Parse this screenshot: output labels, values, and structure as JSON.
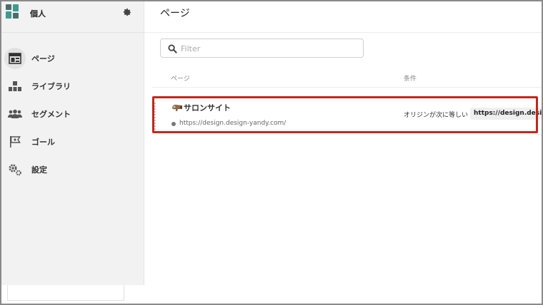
{
  "sidebar": {
    "workspace_name": "個人",
    "items": [
      {
        "label": "ページ",
        "icon": "page-layout-icon",
        "active": true
      },
      {
        "label": "ライブラリ",
        "icon": "library-blocks-icon",
        "active": false
      },
      {
        "label": "セグメント",
        "icon": "users-group-icon",
        "active": false
      },
      {
        "label": "ゴール",
        "icon": "goal-flag-icon",
        "active": false
      },
      {
        "label": "設定",
        "icon": "settings-gears-icon",
        "active": false
      }
    ]
  },
  "main": {
    "title": "ページ",
    "filter": {
      "placeholder": "Filter",
      "value": ""
    },
    "table": {
      "columns": [
        "ページ",
        "条件"
      ],
      "rows": [
        {
          "title": "サロンサイト",
          "url": "https://design.design-yandy.com/",
          "condition_label": "オリジンが次に等しい",
          "condition_value": "https://design.design-yandy.com"
        }
      ]
    }
  },
  "colors": {
    "sidebar_bg": "#f2f2f2",
    "highlight": "#c0281b",
    "logo": "#3f9a8f"
  }
}
